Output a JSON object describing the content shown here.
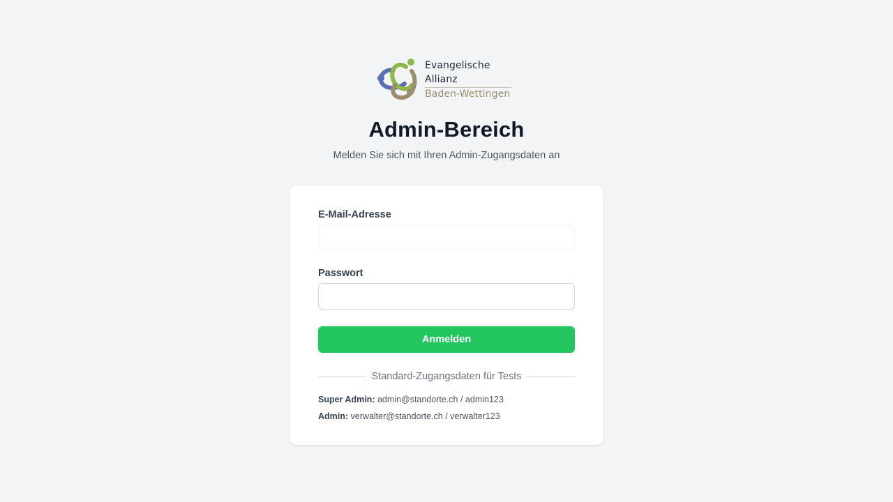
{
  "logo": {
    "line1": "Evangelische",
    "line2": "Allianz",
    "line3": "Baden-Wettingen",
    "colors": {
      "green": "#8db94a",
      "blue": "#5a6fb3",
      "brown": "#9a8f6c"
    }
  },
  "header": {
    "title": "Admin-Bereich",
    "subtitle": "Melden Sie sich mit Ihren Admin-Zugangsdaten an"
  },
  "form": {
    "email_label": "E-Mail-Adresse",
    "email_value": "",
    "password_label": "Passwort",
    "password_value": "",
    "submit_label": "Anmelden",
    "submit_color": "#22c55e"
  },
  "test_credentials": {
    "heading": "Standard-Zugangsdaten für Tests",
    "entries": [
      {
        "role": "Super Admin:",
        "value": "admin@standorte.ch / admin123"
      },
      {
        "role": "Admin:",
        "value": "verwalter@standorte.ch / verwalter123"
      }
    ]
  }
}
